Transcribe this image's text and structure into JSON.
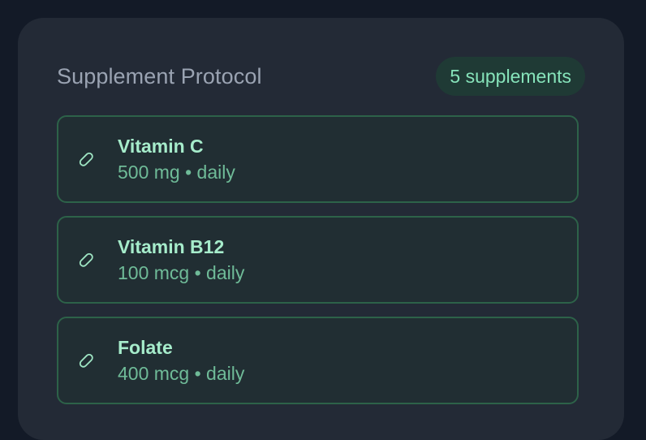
{
  "card": {
    "title": "Supplement Protocol",
    "count_label": "5 supplements"
  },
  "supplements": [
    {
      "name": "Vitamin C",
      "detail": "500 mg • daily",
      "icon": "pill-icon"
    },
    {
      "name": "Vitamin B12",
      "detail": "100 mcg • daily",
      "icon": "pill-icon"
    },
    {
      "name": "Folate",
      "detail": "400 mcg • daily",
      "icon": "pill-icon"
    }
  ],
  "colors": {
    "background": "#131a27",
    "card": "#232a36",
    "accent": "#86e3ba",
    "item_border": "#2d6249"
  }
}
